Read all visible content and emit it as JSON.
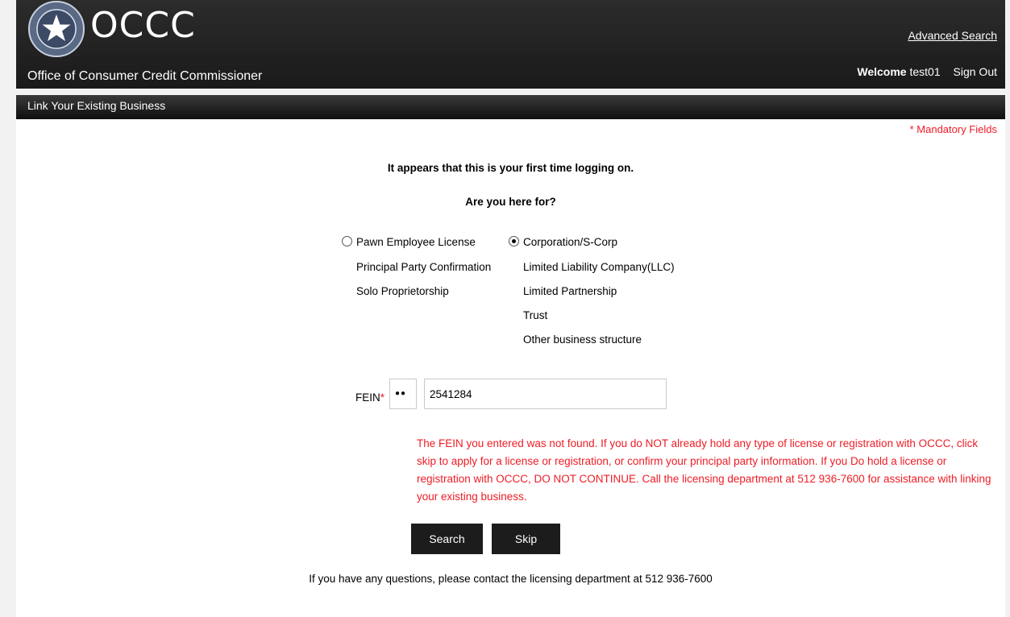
{
  "header": {
    "logo_text": "OCCC",
    "org_name": "Office of Consumer Credit Commissioner",
    "advanced_search": "Advanced Search",
    "welcome_label": "Welcome",
    "username": "test01",
    "sign_out": "Sign Out"
  },
  "subbar": {
    "title": "Link Your Existing Business"
  },
  "main": {
    "mandatory_note": "* Mandatory Fields",
    "headline": "It appears that this is your first time logging on.",
    "question": "Are you here for?",
    "options": {
      "left": {
        "label": "Pawn Employee License",
        "items": [
          "Principal Party Confirmation",
          "Solo Proprietorship"
        ],
        "selected": false
      },
      "right": {
        "label": "Corporation/S-Corp",
        "items": [
          "Limited Liability Company(LLC)",
          "Limited Partnership",
          "Trust",
          "Other business structure"
        ],
        "selected": true
      }
    },
    "fein": {
      "label": "FEIN",
      "required_mark": "*",
      "prefix_masked": "●●",
      "value": "2541284"
    },
    "error_message": "The FEIN you entered was not found. If you do NOT already hold any type of license or registration with OCCC, click skip to apply for a license or registration, or confirm your principal party information. If you Do hold a license or registration with OCCC, DO NOT CONTINUE. Call the licensing department at 512 936-7600 for assistance with linking your existing business.",
    "buttons": {
      "search": "Search",
      "skip": "Skip"
    },
    "footer_note": "If you have any questions, please contact the licensing department at 512 936-7600"
  },
  "colors": {
    "header_bg": "#1a1a1a",
    "error_red": "#ee1c25",
    "button_bg": "#1c1c1c"
  }
}
